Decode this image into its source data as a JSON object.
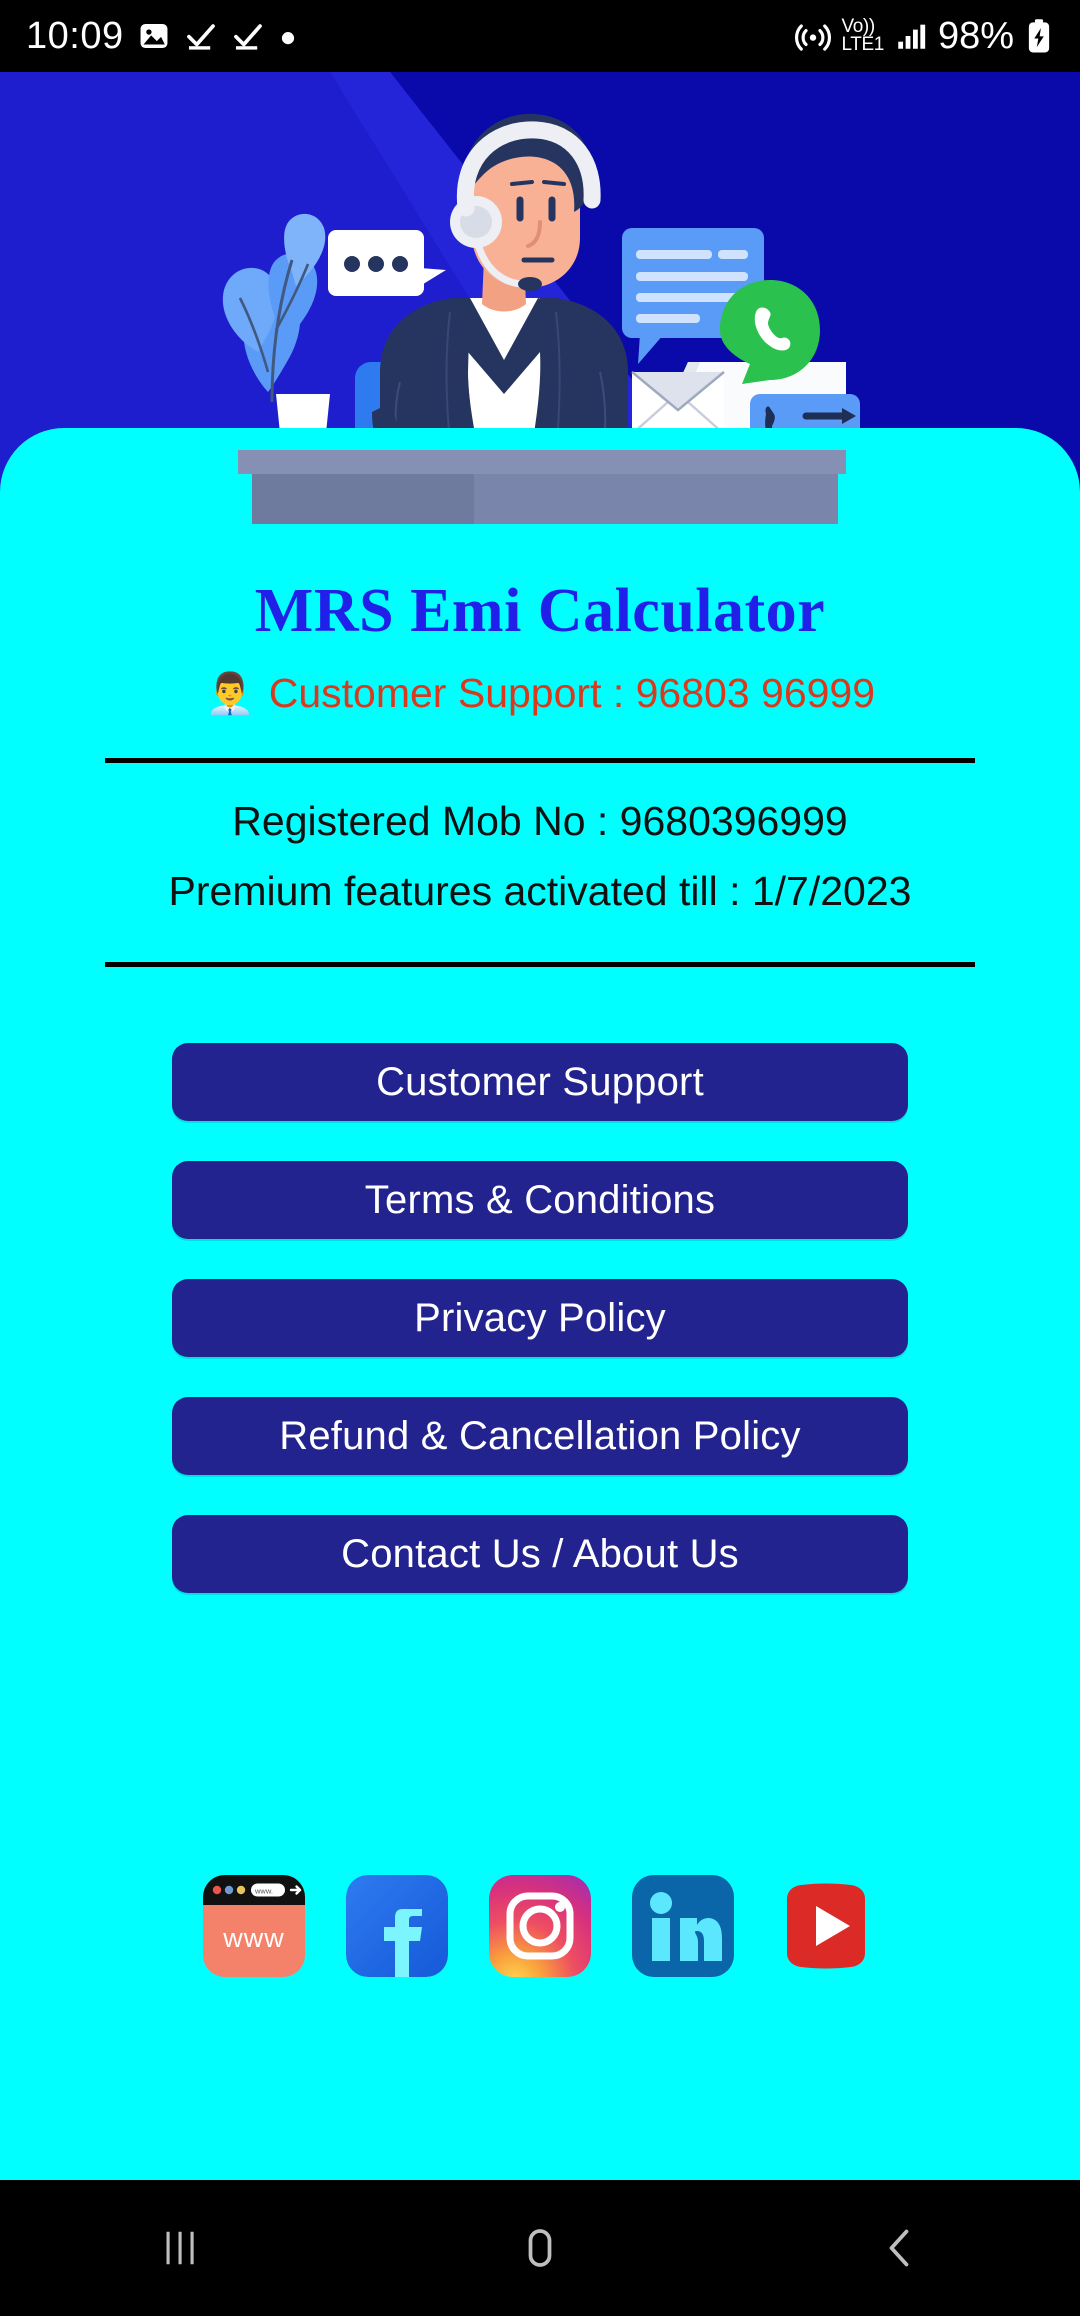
{
  "status_bar": {
    "time": "10:09",
    "icons_left": [
      "image-icon",
      "checkmark-icon",
      "checkmark-icon",
      "dot-icon"
    ],
    "network_label_top": "Vo))",
    "network_label_bottom": "LTE1",
    "icons_right": [
      "hotspot-icon",
      "volte-icon",
      "signal-bars-icon",
      "battery-charging-icon"
    ],
    "battery_percent": "98%"
  },
  "hero": {
    "illustration_name": "customer-support-agent-illustration",
    "bg_color_left": "#1E1ECE",
    "bg_color_right": "#0A0AAA"
  },
  "header": {
    "app_title": "MRS Emi Calculator",
    "title_color": "#2020E8",
    "support_emoji": "👨‍💼",
    "support_text": "Customer Support : 96803 96999",
    "support_color": "#D93A1E"
  },
  "account_info": {
    "registered_mobile": "Registered Mob No : 9680396999",
    "premium_till": "Premium features activated till : 1/7/2023"
  },
  "buttons": [
    {
      "label": "Customer Support",
      "name": "customer-support-button"
    },
    {
      "label": "Terms & Conditions",
      "name": "terms-and-conditions-button"
    },
    {
      "label": "Privacy Policy",
      "name": "privacy-policy-button"
    },
    {
      "label": "Refund & Cancellation Policy",
      "name": "refund-and-cancellation-policy-button"
    },
    {
      "label": "Contact Us / About Us",
      "name": "contact-us-about-us-button"
    }
  ],
  "button_style": {
    "background": "#232390",
    "text_color": "#FFFFFF"
  },
  "social": [
    {
      "name": "website-icon",
      "label": "www",
      "color": "#F4826A"
    },
    {
      "name": "facebook-icon",
      "label": "Facebook",
      "color": "#1977F2"
    },
    {
      "name": "instagram-icon",
      "label": "Instagram",
      "color": "#D82F7C"
    },
    {
      "name": "linkedin-icon",
      "label": "LinkedIn",
      "color": "#0A66A8"
    },
    {
      "name": "youtube-icon",
      "label": "YouTube",
      "color": "#DC2B27"
    }
  ],
  "theme": {
    "panel_background": "#00FFFF",
    "divider_color": "#000000",
    "info_text_color": "#111111"
  },
  "nav_bar": {
    "recents_label": "Recents",
    "home_label": "Home",
    "back_label": "Back"
  }
}
